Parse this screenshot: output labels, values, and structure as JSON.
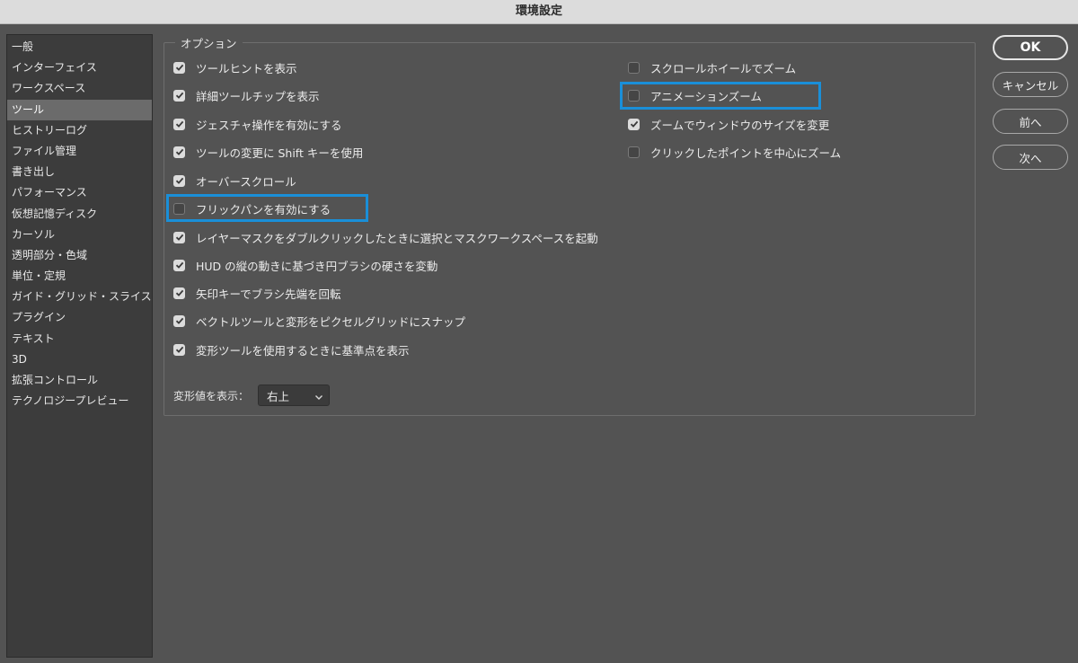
{
  "window": {
    "title": "環境設定"
  },
  "sidebar": {
    "items": [
      {
        "label": "一般"
      },
      {
        "label": "インターフェイス"
      },
      {
        "label": "ワークスペース"
      },
      {
        "label": "ツール",
        "selected": true
      },
      {
        "label": "ヒストリーログ"
      },
      {
        "label": "ファイル管理"
      },
      {
        "label": "書き出し"
      },
      {
        "label": "パフォーマンス"
      },
      {
        "label": "仮想記憶ディスク"
      },
      {
        "label": "カーソル"
      },
      {
        "label": "透明部分・色域"
      },
      {
        "label": "単位・定規"
      },
      {
        "label": "ガイド・グリッド・スライス"
      },
      {
        "label": "プラグイン"
      },
      {
        "label": "テキスト"
      },
      {
        "label": "3D"
      },
      {
        "label": "拡張コントロール"
      },
      {
        "label": "テクノロジープレビュー"
      }
    ]
  },
  "options": {
    "title": "オプション",
    "left": [
      {
        "label": "ツールヒントを表示",
        "checked": true
      },
      {
        "label": "詳細ツールチップを表示",
        "checked": true
      },
      {
        "label": "ジェスチャ操作を有効にする",
        "checked": true
      },
      {
        "label": "ツールの変更に Shift キーを使用",
        "checked": true
      },
      {
        "label": "オーバースクロール",
        "checked": true
      },
      {
        "label": "フリックパンを有効にする",
        "checked": false,
        "highlighted": true
      },
      {
        "label": "レイヤーマスクをダブルクリックしたときに選択とマスクワークスペースを起動",
        "checked": true
      },
      {
        "label": "HUD の縦の動きに基づき円ブラシの硬さを変動",
        "checked": true
      },
      {
        "label": "矢印キーでブラシ先端を回転",
        "checked": true
      },
      {
        "label": "ベクトルツールと変形をピクセルグリッドにスナップ",
        "checked": true
      },
      {
        "label": "変形ツールを使用するときに基準点を表示",
        "checked": true
      }
    ],
    "right": [
      {
        "label": "スクロールホイールでズーム",
        "checked": false
      },
      {
        "label": "アニメーションズーム",
        "checked": false,
        "highlighted": true
      },
      {
        "label": "ズームでウィンドウのサイズを変更",
        "checked": true
      },
      {
        "label": "クリックしたポイントを中心にズーム",
        "checked": false
      }
    ],
    "transform_values": {
      "label": "変形値を表示：",
      "value": "右上"
    }
  },
  "buttons": {
    "ok": "OK",
    "cancel": "キャンセル",
    "prev": "前へ",
    "next": "次へ"
  },
  "colors": {
    "highlight": "#1a8fd8",
    "background": "#535353",
    "sidebar": "#3c3c3c"
  }
}
